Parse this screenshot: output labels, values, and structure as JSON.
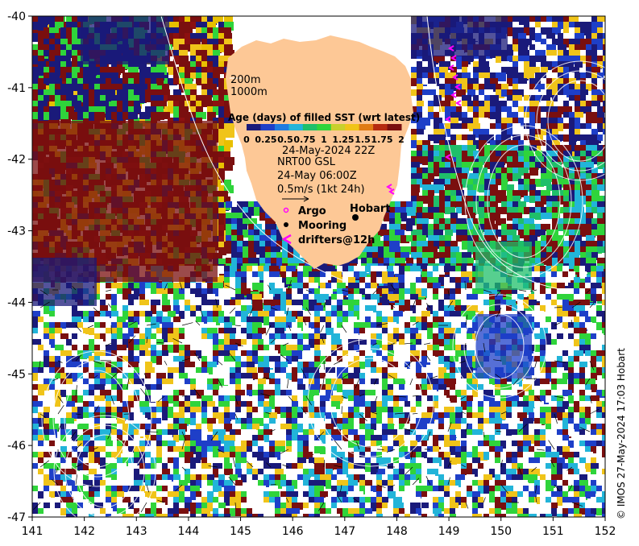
{
  "map": {
    "x_ticks": [
      "141",
      "142",
      "143",
      "144",
      "145",
      "146",
      "147",
      "148",
      "149",
      "150",
      "151",
      "152"
    ],
    "y_ticks": [
      "-40",
      "-41",
      "-42",
      "-43",
      "-44",
      "-45",
      "-46",
      "-47"
    ],
    "lon_range": [
      141,
      152
    ],
    "lat_range": [
      -47,
      -40
    ],
    "depth_legend": [
      "200m",
      "1000m"
    ],
    "colorbar": {
      "title": "Age (days) of filled SST (wrt latest)",
      "labels": [
        "0",
        "0.25",
        "0.5",
        "0.75",
        "1",
        "1.25",
        "1.5",
        "1.75",
        "2"
      ],
      "colors": [
        "#1a1a7a",
        "#1e3fc8",
        "#1f7be0",
        "#22b4d9",
        "#1fbf6a",
        "#2fd43b",
        "#c8d02c",
        "#f0c419",
        "#e07b14",
        "#b52a10",
        "#7a0f0f"
      ]
    },
    "date": "24-May-2024 22Z",
    "currents_source": "NRT00 GSL",
    "currents_time": "24-May 06:00Z",
    "vector_scale": "0.5m/s (1kt 24h)",
    "symbols": [
      {
        "label": "Argo",
        "symbol": "o",
        "color": "#ff00ff"
      },
      {
        "label": "Mooring",
        "symbol": "●",
        "color": "#000000"
      },
      {
        "label": "drifters@12h",
        "symbol": "<",
        "color": "#ff00ff"
      }
    ],
    "city": "Hobart",
    "credit": "© IMOS 27-May-2024 17:03 Hobart",
    "land_color": "#fdc896"
  }
}
